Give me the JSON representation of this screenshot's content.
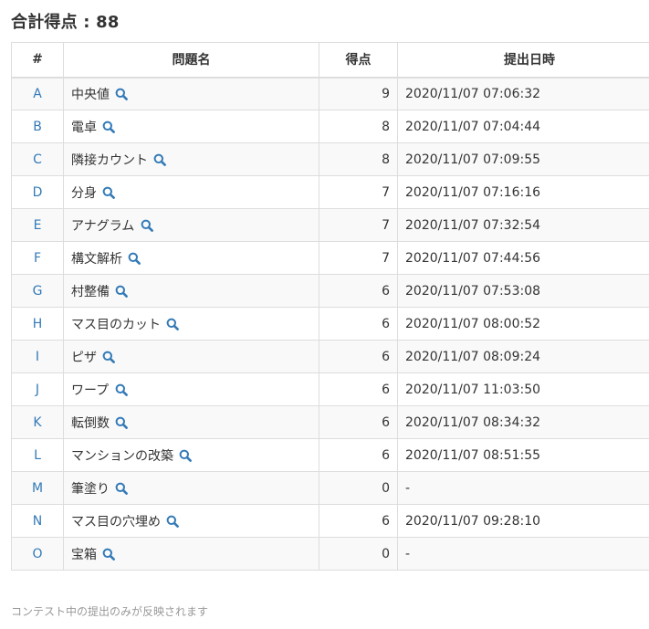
{
  "header": {
    "title": "合計得点 : 88"
  },
  "table": {
    "columns": [
      "#",
      "問題名",
      "得点",
      "提出日時"
    ],
    "rows": [
      {
        "id": "A",
        "name": "中央値",
        "score": "9",
        "time": "2020/11/07 07:06:32"
      },
      {
        "id": "B",
        "name": "電卓",
        "score": "8",
        "time": "2020/11/07 07:04:44"
      },
      {
        "id": "C",
        "name": "隣接カウント",
        "score": "8",
        "time": "2020/11/07 07:09:55"
      },
      {
        "id": "D",
        "name": "分身",
        "score": "7",
        "time": "2020/11/07 07:16:16"
      },
      {
        "id": "E",
        "name": "アナグラム",
        "score": "7",
        "time": "2020/11/07 07:32:54"
      },
      {
        "id": "F",
        "name": "構文解析",
        "score": "7",
        "time": "2020/11/07 07:44:56"
      },
      {
        "id": "G",
        "name": "村整備",
        "score": "6",
        "time": "2020/11/07 07:53:08"
      },
      {
        "id": "H",
        "name": "マス目のカット",
        "score": "6",
        "time": "2020/11/07 08:00:52"
      },
      {
        "id": "I",
        "name": "ピザ",
        "score": "6",
        "time": "2020/11/07 08:09:24"
      },
      {
        "id": "J",
        "name": "ワープ",
        "score": "6",
        "time": "2020/11/07 11:03:50"
      },
      {
        "id": "K",
        "name": "転倒数",
        "score": "6",
        "time": "2020/11/07 08:34:32"
      },
      {
        "id": "L",
        "name": "マンションの改築",
        "score": "6",
        "time": "2020/11/07 08:51:55"
      },
      {
        "id": "M",
        "name": "筆塗り",
        "score": "0",
        "time": "-"
      },
      {
        "id": "N",
        "name": "マス目の穴埋め",
        "score": "6",
        "time": "2020/11/07 09:28:10"
      },
      {
        "id": "O",
        "name": "宝箱",
        "score": "0",
        "time": "-"
      }
    ]
  },
  "footer": {
    "note": "コンテスト中の提出のみが反映されます"
  },
  "colors": {
    "link": "#337ab7",
    "border": "#dddddd",
    "stripe": "#f9f9f9",
    "note": "#999999"
  }
}
